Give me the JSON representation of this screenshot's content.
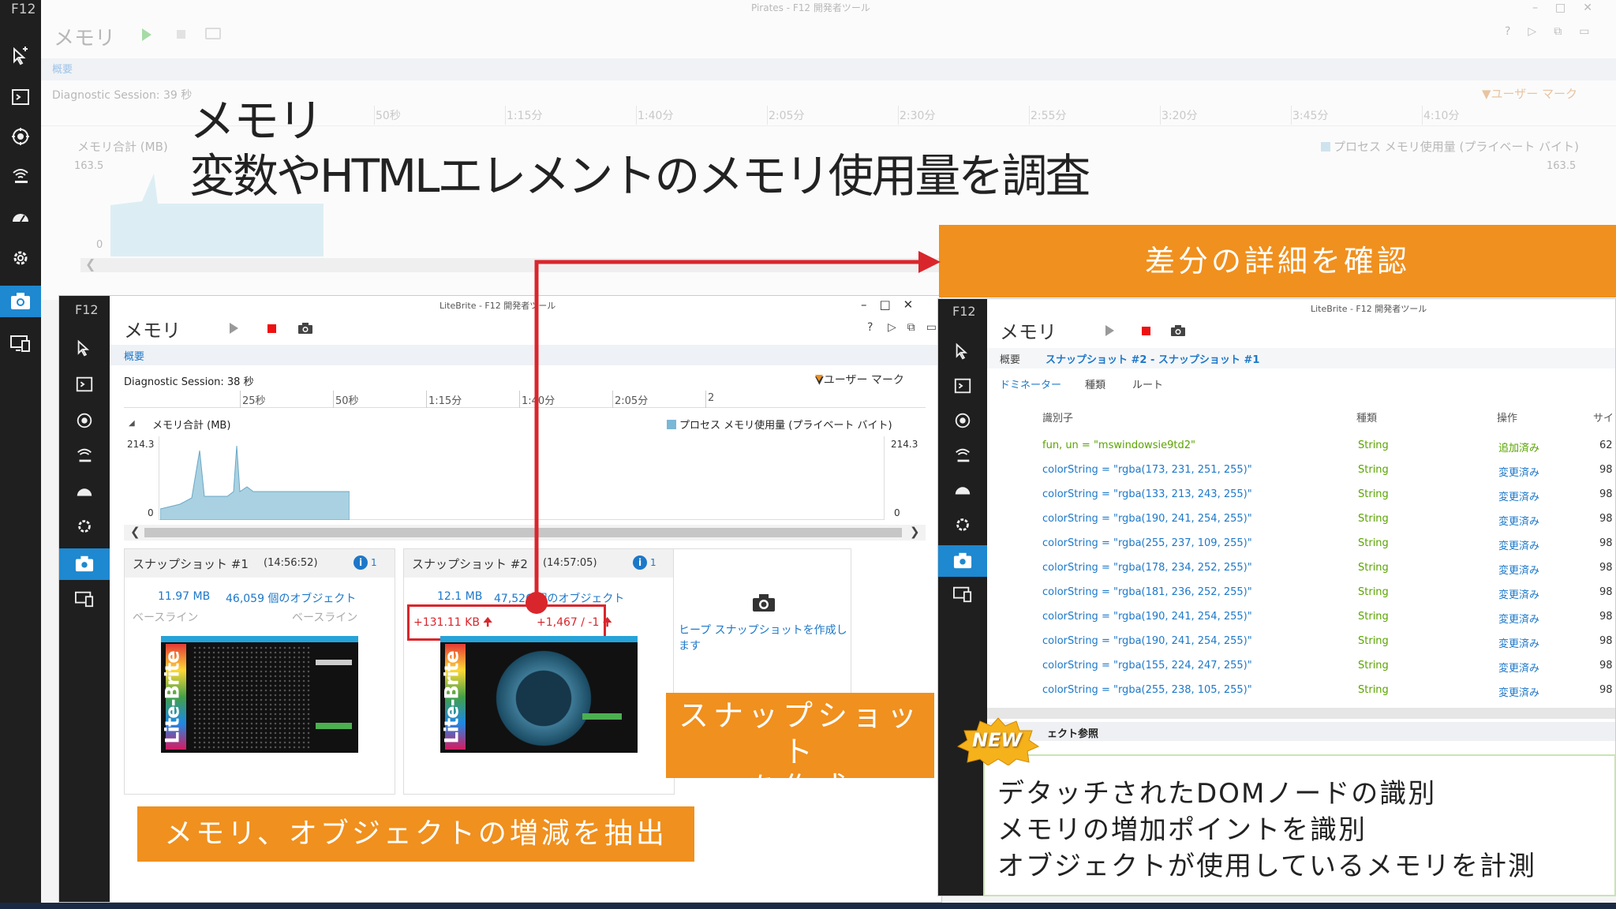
{
  "bg_window": {
    "title": "Pirates - F12 開発者ツール",
    "rail_label": "F12",
    "tool_title": "メモリ",
    "tab_overview": "概要",
    "session": "Diagnostic Session: 39 秒",
    "user_mark": "▼ユーザー マーク",
    "ticks": [
      "50秒",
      "1:15分",
      "1:40分",
      "2:05分",
      "2:30分",
      "2:55分",
      "3:20分",
      "3:45分",
      "4:10分"
    ],
    "chart_label": "メモリ合計 (MB)",
    "legend": "プロセス メモリ使用量 (プライベート バイト)",
    "y_max": "163.5",
    "y_min": "0",
    "chart_data": {
      "type": "area",
      "title": "メモリ合計 (MB)",
      "ylim": [
        0,
        163.5
      ],
      "series": [
        {
          "name": "プロセス メモリ使用量 (プライベート バイト)"
        }
      ]
    }
  },
  "overlay": {
    "heading_line1": "メモリ",
    "heading_line2": "変数やHTMLエレメントのメモリ使用量を調査",
    "callout_diff": "差分の詳細を確認",
    "callout_snapshot_line1": "スナップショット",
    "callout_snapshot_line2": "を作成",
    "callout_extract": "メモリ、オブジェクトの増減を抽出",
    "new_badge": "NEW",
    "features": [
      "デタッチされたDOMノードの識別",
      "メモリの増加ポイントを識別",
      "オブジェクトが使用しているメモリを計測"
    ]
  },
  "left_window": {
    "title": "LiteBrite - F12 開発者ツール",
    "rail_label": "F12",
    "tool_title": "メモリ",
    "tab_overview": "概要",
    "session": "Diagnostic Session: 38 秒",
    "user_mark": "▼ユーザー マーク",
    "ticks": [
      "25秒",
      "50秒",
      "1:15分",
      "1:40分",
      "2:05分",
      "2"
    ],
    "chart_label": "メモリ合計 (MB)",
    "legend": "プロセス メモリ使用量 (プライベート バイト)",
    "y_max": "214.3",
    "y_min": "0",
    "chart_data": {
      "type": "area",
      "title": "メモリ合計 (MB)",
      "ylim": [
        0,
        214.3
      ],
      "series": [
        {
          "name": "プロセス メモリ使用量 (プライベート バイト)"
        }
      ]
    },
    "snapshots": [
      {
        "title": "スナップショット #1",
        "time": "(14:56:52)",
        "info": "1",
        "size": "11.97 MB",
        "objects": "46,059 個のオブジェクト",
        "size_sub": "ベースライン",
        "objects_sub": "ベースライン"
      },
      {
        "title": "スナップショット #2",
        "time": "(14:57:05)",
        "info": "1",
        "size": "12.1 MB",
        "objects": "47,526 個のオブジェクト",
        "size_diff": "+131.11 KB",
        "objects_diff": "+1,467 / -1"
      }
    ],
    "take_snapshot": "ヒープ スナップショットを作成します",
    "thumb_text": "Lite-Brite"
  },
  "right_window": {
    "title": "LiteBrite - F12 開発者ツール",
    "rail_label": "F12",
    "tool_title": "メモリ",
    "breadcrumb_overview": "概要",
    "breadcrumb_current": "スナップショット #2 - スナップショット #1",
    "view_tabs": [
      "ドミネーター",
      "種類",
      "ルート"
    ],
    "columns": [
      "識別子",
      "種類",
      "操作",
      "サイ"
    ],
    "rows": [
      {
        "id": "fun, un = \"mswindowsie9td2\"",
        "type": "String",
        "op": "追加済み",
        "size": "62",
        "added": true
      },
      {
        "id": "colorString = \"rgba(173, 231, 251, 255)\"",
        "type": "String",
        "op": "変更済み",
        "size": "98"
      },
      {
        "id": "colorString = \"rgba(133, 213, 243, 255)\"",
        "type": "String",
        "op": "変更済み",
        "size": "98"
      },
      {
        "id": "colorString = \"rgba(190, 241, 254, 255)\"",
        "type": "String",
        "op": "変更済み",
        "size": "98"
      },
      {
        "id": "colorString = \"rgba(255, 237, 109, 255)\"",
        "type": "String",
        "op": "変更済み",
        "size": "98"
      },
      {
        "id": "colorString = \"rgba(178, 234, 252, 255)\"",
        "type": "String",
        "op": "変更済み",
        "size": "98"
      },
      {
        "id": "colorString = \"rgba(181, 236, 252, 255)\"",
        "type": "String",
        "op": "変更済み",
        "size": "98"
      },
      {
        "id": "colorString = \"rgba(190, 241, 254, 255)\"",
        "type": "String",
        "op": "変更済み",
        "size": "98"
      },
      {
        "id": "colorString = \"rgba(190, 241, 254, 255)\"",
        "type": "String",
        "op": "変更済み",
        "size": "98"
      },
      {
        "id": "colorString = \"rgba(155, 224, 247, 255)\"",
        "type": "String",
        "op": "変更済み",
        "size": "98"
      },
      {
        "id": "colorString = \"rgba(255, 238, 105, 255)\"",
        "type": "String",
        "op": "変更済み",
        "size": "98"
      }
    ],
    "object_ref_label": "ェクト参照"
  }
}
